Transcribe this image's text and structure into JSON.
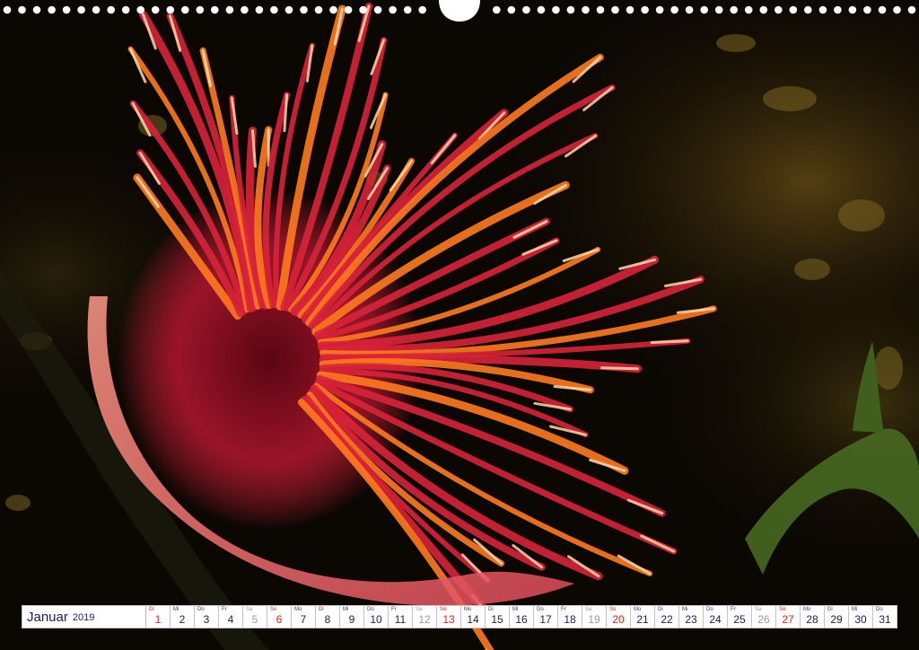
{
  "calendar": {
    "month": "Januar",
    "year": "2019",
    "days": [
      {
        "num": "1",
        "wd": "Di",
        "type": "sun"
      },
      {
        "num": "2",
        "wd": "Mi",
        "type": "work"
      },
      {
        "num": "3",
        "wd": "Do",
        "type": "work"
      },
      {
        "num": "4",
        "wd": "Fr",
        "type": "work"
      },
      {
        "num": "5",
        "wd": "Sa",
        "type": "sat"
      },
      {
        "num": "6",
        "wd": "So",
        "type": "sun"
      },
      {
        "num": "7",
        "wd": "Mo",
        "type": "work"
      },
      {
        "num": "8",
        "wd": "Di",
        "type": "work"
      },
      {
        "num": "9",
        "wd": "Mi",
        "type": "work"
      },
      {
        "num": "10",
        "wd": "Do",
        "type": "work"
      },
      {
        "num": "11",
        "wd": "Fr",
        "type": "work"
      },
      {
        "num": "12",
        "wd": "Sa",
        "type": "sat"
      },
      {
        "num": "13",
        "wd": "So",
        "type": "sun"
      },
      {
        "num": "14",
        "wd": "Mo",
        "type": "work"
      },
      {
        "num": "15",
        "wd": "Di",
        "type": "work"
      },
      {
        "num": "16",
        "wd": "Mi",
        "type": "work"
      },
      {
        "num": "17",
        "wd": "Do",
        "type": "work"
      },
      {
        "num": "18",
        "wd": "Fr",
        "type": "work"
      },
      {
        "num": "19",
        "wd": "Sa",
        "type": "sat"
      },
      {
        "num": "20",
        "wd": "So",
        "type": "sun"
      },
      {
        "num": "21",
        "wd": "Mo",
        "type": "work"
      },
      {
        "num": "22",
        "wd": "Di",
        "type": "work"
      },
      {
        "num": "23",
        "wd": "Mi",
        "type": "work"
      },
      {
        "num": "24",
        "wd": "Do",
        "type": "work"
      },
      {
        "num": "25",
        "wd": "Fr",
        "type": "work"
      },
      {
        "num": "26",
        "wd": "Sa",
        "type": "sat"
      },
      {
        "num": "27",
        "wd": "So",
        "type": "sun"
      },
      {
        "num": "28",
        "wd": "Mo",
        "type": "work"
      },
      {
        "num": "29",
        "wd": "Di",
        "type": "work"
      },
      {
        "num": "30",
        "wd": "Mi",
        "type": "work"
      },
      {
        "num": "31",
        "wd": "Do",
        "type": "work"
      }
    ]
  },
  "photo": {
    "subject": "fan-worm-icon",
    "colors": {
      "background": "#0b0703",
      "tentacle_red": "#d8243a",
      "tentacle_orange": "#ff7a1e",
      "tentacle_tip": "#ffd9a8",
      "seaweed": "#4a6e22"
    }
  },
  "binding": {
    "hole_count": 62,
    "color": "#ffffff"
  }
}
